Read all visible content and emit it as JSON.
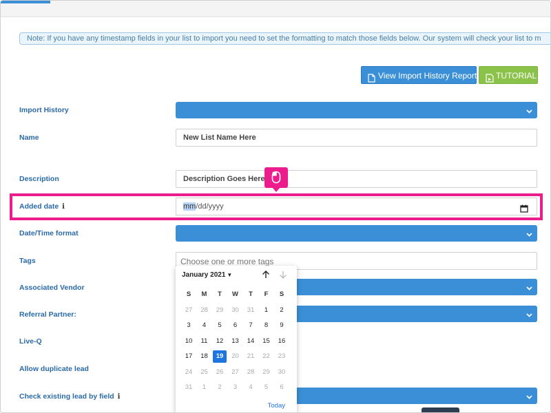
{
  "note": "Note: If you have any timestamp fields in your list to import you need to set the formatting to match those fields below. Our system will check your list to m",
  "buttons": {
    "history": "View Import History Report",
    "tutorial": "TUTORIAL"
  },
  "fields": {
    "import_history": "Import History",
    "name": "Name",
    "name_value": "New List Name Here",
    "description": "Description",
    "description_value": "Description Goes Here",
    "added_date": "Added date",
    "added_date_mm": "mm",
    "added_date_rest": "/dd/yyyy",
    "datetime_format": "Date/Time format",
    "tags": "Tags",
    "tags_placeholder": "Choose one or more tags",
    "associated_vendor": "Associated Vendor",
    "referral_partner": "Referral Partner:",
    "live_q": "Live-Q",
    "allow_duplicate": "Allow duplicate lead",
    "check_existing": "Check existing lead by field"
  },
  "datepicker": {
    "month_label": "January 2021",
    "weekdays": [
      "S",
      "M",
      "T",
      "W",
      "T",
      "F",
      "S"
    ],
    "weeks": [
      [
        {
          "d": "27",
          "s": "out"
        },
        {
          "d": "28",
          "s": "out"
        },
        {
          "d": "29",
          "s": "out"
        },
        {
          "d": "30",
          "s": "out"
        },
        {
          "d": "31",
          "s": "out"
        },
        {
          "d": "1",
          "s": "in"
        },
        {
          "d": "2",
          "s": "in"
        }
      ],
      [
        {
          "d": "3",
          "s": "in"
        },
        {
          "d": "4",
          "s": "in"
        },
        {
          "d": "5",
          "s": "in"
        },
        {
          "d": "6",
          "s": "in"
        },
        {
          "d": "7",
          "s": "in"
        },
        {
          "d": "8",
          "s": "in"
        },
        {
          "d": "9",
          "s": "in"
        }
      ],
      [
        {
          "d": "10",
          "s": "in"
        },
        {
          "d": "11",
          "s": "in"
        },
        {
          "d": "12",
          "s": "in"
        },
        {
          "d": "13",
          "s": "in"
        },
        {
          "d": "14",
          "s": "in"
        },
        {
          "d": "15",
          "s": "in"
        },
        {
          "d": "16",
          "s": "in"
        }
      ],
      [
        {
          "d": "17",
          "s": "in"
        },
        {
          "d": "18",
          "s": "in"
        },
        {
          "d": "19",
          "s": "sel"
        },
        {
          "d": "20",
          "s": "out"
        },
        {
          "d": "21",
          "s": "out"
        },
        {
          "d": "22",
          "s": "out"
        },
        {
          "d": "23",
          "s": "out"
        }
      ],
      [
        {
          "d": "24",
          "s": "out"
        },
        {
          "d": "25",
          "s": "out"
        },
        {
          "d": "26",
          "s": "out"
        },
        {
          "d": "27",
          "s": "out"
        },
        {
          "d": "28",
          "s": "out"
        },
        {
          "d": "29",
          "s": "out"
        },
        {
          "d": "30",
          "s": "out"
        }
      ],
      [
        {
          "d": "31",
          "s": "out"
        },
        {
          "d": "1",
          "s": "out"
        },
        {
          "d": "2",
          "s": "out"
        },
        {
          "d": "3",
          "s": "out"
        },
        {
          "d": "4",
          "s": "out"
        },
        {
          "d": "5",
          "s": "out"
        },
        {
          "d": "6",
          "s": "out"
        }
      ]
    ],
    "today_label": "Today"
  },
  "colors": {
    "accent": "#3a8fd6",
    "tutorial": "#8bc34a",
    "highlight": "#ec1c8c",
    "selected_day": "#1f75e0"
  },
  "icons": [
    "document-icon",
    "video-icon",
    "chevron-down-icon",
    "calendar-icon",
    "mouse-icon",
    "arrow-up-icon",
    "arrow-down-icon",
    "info-icon"
  ]
}
